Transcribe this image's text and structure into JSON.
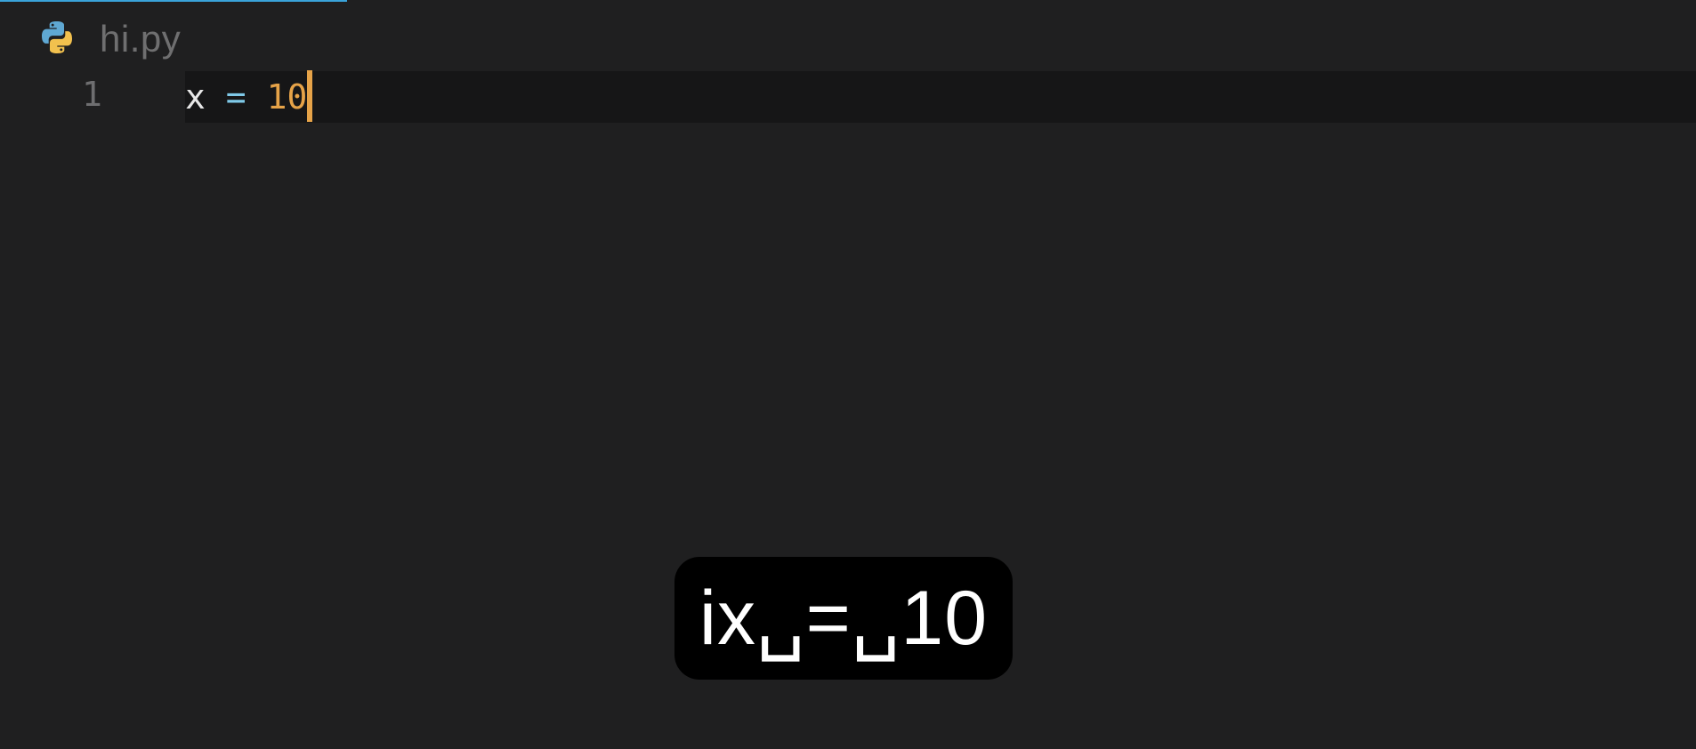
{
  "tab": {
    "filename": "hi.py",
    "icon": "python-icon"
  },
  "editor": {
    "line_number": "1",
    "code": {
      "name": "x",
      "sp1": " ",
      "operator": "=",
      "sp2": " ",
      "number": "10"
    }
  },
  "keystroke_overlay": {
    "text": "ix␣=␣10"
  },
  "colors": {
    "background": "#1f1f20",
    "accent": "#3aa3d9",
    "number": "#e6a348",
    "operator": "#7fc9e8"
  }
}
